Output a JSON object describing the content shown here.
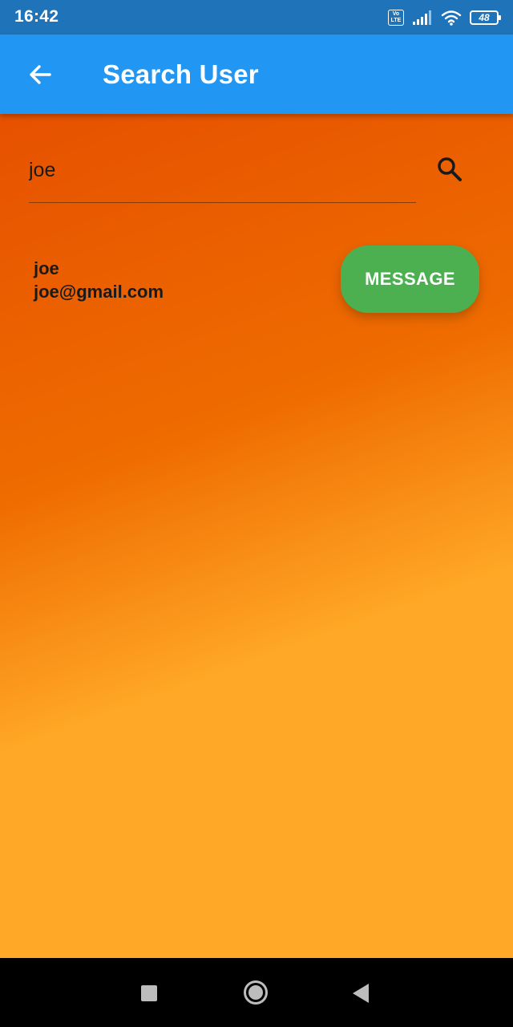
{
  "status_bar": {
    "time": "16:42",
    "volte_label": "Vo LTE",
    "battery_level": "48",
    "icons": [
      "volte-icon",
      "signal-icon",
      "wifi-icon",
      "battery-icon"
    ]
  },
  "app_bar": {
    "title": "Search User",
    "back_icon": "arrow-back-icon",
    "color": "#2196f3"
  },
  "search": {
    "value": "joe",
    "placeholder": "",
    "icon": "search-icon"
  },
  "results": [
    {
      "name": "joe",
      "email": "joe@gmail.com",
      "action_label": "MESSAGE"
    }
  ],
  "colors": {
    "status_bar": "#1f73b9",
    "gradient_start": "#e65100",
    "gradient_end": "#ffa726",
    "message_button": "#4caf50"
  },
  "nav_bar": {
    "icons": [
      "recents-icon",
      "home-icon",
      "back-icon"
    ]
  }
}
